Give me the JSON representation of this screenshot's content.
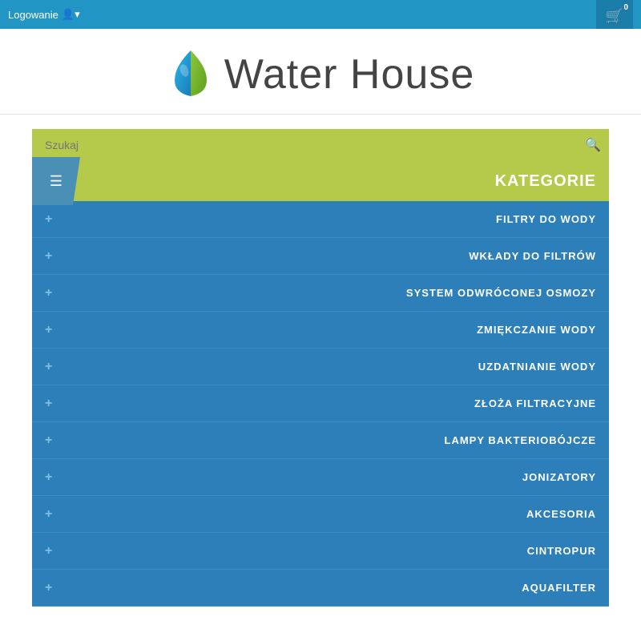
{
  "topbar": {
    "login_label": "Logowanie",
    "cart_badge": "0"
  },
  "logo": {
    "text": "Water House"
  },
  "search": {
    "placeholder": "Szukaj"
  },
  "categories": {
    "title": "KATEGORIE",
    "items": [
      {
        "label": "FILTRY DO WODY"
      },
      {
        "label": "WKŁADY DO FILTRÓW"
      },
      {
        "label": "SYSTEM ODWRÓCONEJ OSMOZY"
      },
      {
        "label": "ZMIĘKCZANIE WODY"
      },
      {
        "label": "UZDATNIANIE WODY"
      },
      {
        "label": "ZŁOŻA FILTRACYJNE"
      },
      {
        "label": "LAMPY BAKTERIOBÓJCZE"
      },
      {
        "label": "JONIZATORY"
      },
      {
        "label": "AKCESORIA"
      },
      {
        "label": "CINTROPUR"
      },
      {
        "label": "AQUAFILTER"
      }
    ]
  }
}
